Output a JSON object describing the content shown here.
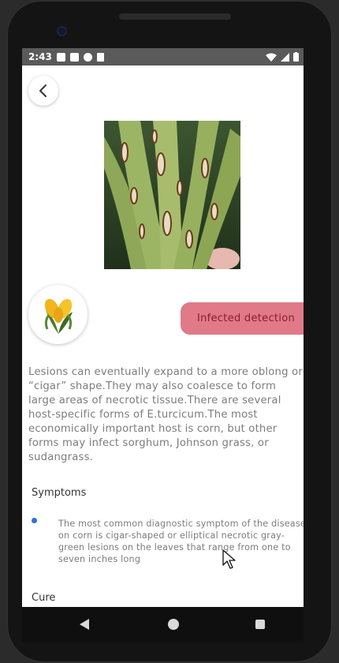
{
  "status_bar": {
    "time": "2:43"
  },
  "header": {
    "back_icon": "chevron-left-icon"
  },
  "detection": {
    "status_label": "Infected detection",
    "status_color": "#e07a88",
    "status_text_color": "#8c1c2c"
  },
  "content": {
    "description": "Lesions can eventually expand to a more oblong or “cigar” shape.They may also coalesce to form large areas of necrotic tissue.There are several host-specific forms of E.turcicum.The most economically important host is corn, but other forms may infect sorghum, Johnson grass, or sudangrass.",
    "symptoms_title": "Symptoms",
    "symptoms": [
      "The most common diagnostic symptom of the disease on corn is cigar-shaped or elliptical necrotic gray-green lesions on the leaves that range from one to seven inches long"
    ],
    "cure_title": "Cure",
    "bullet_color": "#2f73d6"
  },
  "nav": {
    "back_icon": "triangle-back-icon",
    "home_icon": "circle-home-icon",
    "recents_icon": "square-recents-icon"
  }
}
